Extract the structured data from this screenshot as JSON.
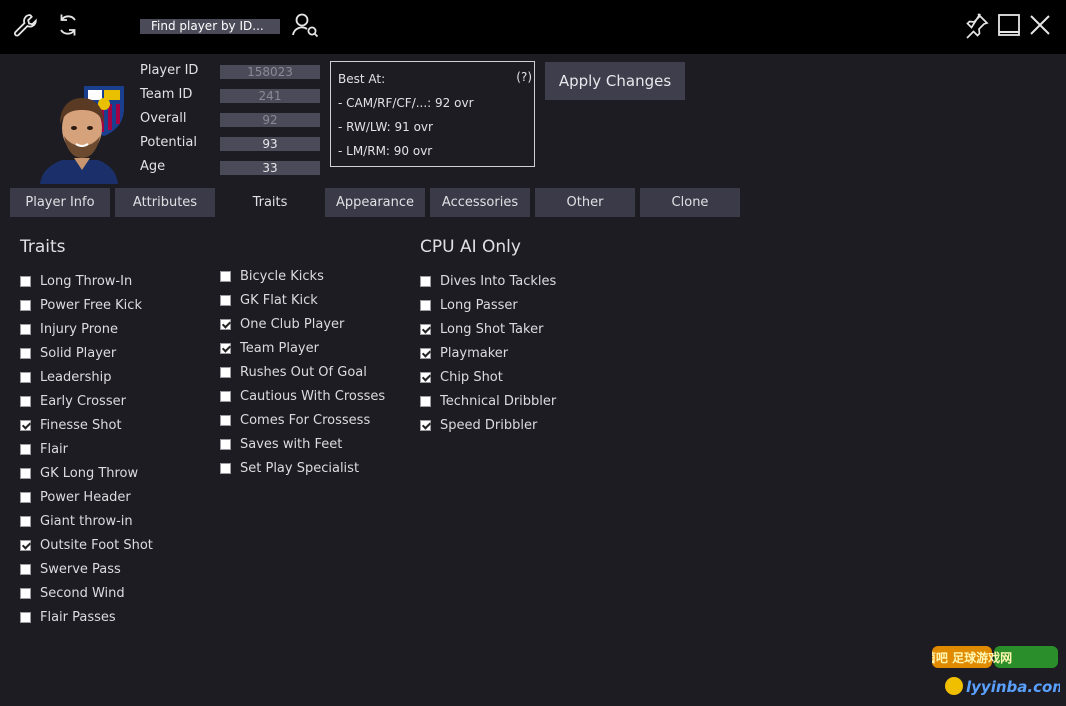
{
  "titlebar": {
    "search_placeholder": "Find player by ID...",
    "icons": [
      "wrench-icon",
      "refresh-icon",
      "user-search-icon",
      "pin-icon",
      "minimize-icon",
      "close-icon"
    ]
  },
  "player": {
    "fields": [
      {
        "label": "Player ID",
        "value": "158023"
      },
      {
        "label": "Team ID",
        "value": "241"
      },
      {
        "label": "Overall",
        "value": "92"
      },
      {
        "label": "Potential",
        "value": "93"
      },
      {
        "label": "Age",
        "value": "33"
      }
    ],
    "best_at": {
      "title": "Best At:",
      "help": "(?)",
      "lines": [
        "- CAM/RF/CF/...: 92 ovr",
        "- RW/LW: 91 ovr",
        "- LM/RM: 90 ovr"
      ]
    },
    "apply_label": "Apply Changes"
  },
  "tabs": [
    "Player Info",
    "Attributes",
    "Traits",
    "Appearance",
    "Accessories",
    "Other",
    "Clone"
  ],
  "active_tab": "Traits",
  "traits_title": "Traits",
  "cpu_title": "CPU AI Only",
  "traits_col1": [
    {
      "label": "Long Throw-In",
      "checked": false
    },
    {
      "label": "Power Free Kick",
      "checked": false
    },
    {
      "label": "Injury Prone",
      "checked": false
    },
    {
      "label": "Solid Player",
      "checked": false
    },
    {
      "label": "Leadership",
      "checked": false
    },
    {
      "label": "Early Crosser",
      "checked": false
    },
    {
      "label": "Finesse Shot",
      "checked": true
    },
    {
      "label": "Flair",
      "checked": false
    },
    {
      "label": "GK Long Throw",
      "checked": false
    },
    {
      "label": "Power Header",
      "checked": false
    },
    {
      "label": "Giant throw-in",
      "checked": false
    },
    {
      "label": "Outsite Foot Shot",
      "checked": true
    },
    {
      "label": "Swerve Pass",
      "checked": false
    },
    {
      "label": "Second Wind",
      "checked": false
    },
    {
      "label": "Flair Passes",
      "checked": false
    }
  ],
  "traits_col2": [
    {
      "label": "Bicycle Kicks",
      "checked": false
    },
    {
      "label": "GK Flat Kick",
      "checked": false
    },
    {
      "label": "One Club Player",
      "checked": true
    },
    {
      "label": "Team Player",
      "checked": true
    },
    {
      "label": "Rushes Out Of Goal",
      "checked": false
    },
    {
      "label": "Cautious With Crosses",
      "checked": false
    },
    {
      "label": "Comes For Crossess",
      "checked": false
    },
    {
      "label": "Saves with Feet",
      "checked": false
    },
    {
      "label": "Set Play Specialist",
      "checked": false
    }
  ],
  "traits_cpu": [
    {
      "label": "Dives Into Tackles",
      "checked": false
    },
    {
      "label": "Long Passer",
      "checked": false
    },
    {
      "label": "Long Shot Taker",
      "checked": true
    },
    {
      "label": "Playmaker",
      "checked": true
    },
    {
      "label": "Chip Shot",
      "checked": true
    },
    {
      "label": "Technical Dribbler",
      "checked": false
    },
    {
      "label": "Speed Dribbler",
      "checked": true
    }
  ],
  "watermark": {
    "line1": "绿茵吧 足球游戏网",
    "line2": "lyyinba.com"
  }
}
